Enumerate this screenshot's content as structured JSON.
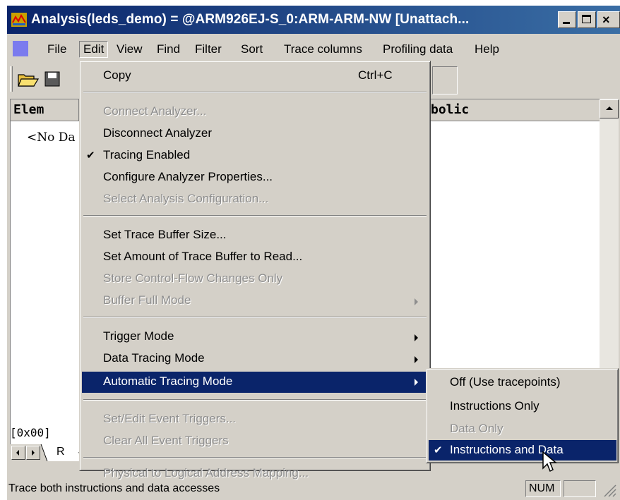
{
  "window": {
    "title": "Analysis(leds_demo) = @ARM926EJ-S_0:ARM-ARM-NW [Unattach...",
    "colors": {
      "titlebar_start": "#0a246a",
      "titlebar_end": "#3a6ea5",
      "highlight": "#0a246a",
      "face": "#d4d0c8"
    }
  },
  "menubar": {
    "items": [
      "File",
      "Edit",
      "View",
      "Find",
      "Filter",
      "Sort",
      "Trace columns",
      "Profiling data",
      "Help"
    ],
    "active": "Edit"
  },
  "toolbar": {
    "icons": [
      "open-folder-icon",
      "save-disk-icon"
    ]
  },
  "table": {
    "header_elem": "Elem",
    "header_symbolic": "bolic",
    "no_data": "<No Da",
    "address": "[0x00]",
    "tab_label": "R"
  },
  "edit_menu": {
    "copy": {
      "label": "Copy",
      "shortcut": "Ctrl+C"
    },
    "connect_analyzer": "Connect Analyzer...",
    "disconnect_analyzer": "Disconnect Analyzer",
    "tracing_enabled": "Tracing Enabled",
    "configure_properties": "Configure Analyzer Properties...",
    "select_config": "Select Analysis Configuration...",
    "set_buffer_size": "Set Trace Buffer Size...",
    "set_amount": "Set Amount of Trace Buffer to Read...",
    "store_control_flow": "Store Control-Flow Changes Only",
    "buffer_full_mode": "Buffer Full Mode",
    "trigger_mode": "Trigger Mode",
    "data_tracing_mode": "Data Tracing Mode",
    "automatic_tracing_mode": "Automatic Tracing Mode",
    "set_edit_triggers": "Set/Edit Event Triggers...",
    "clear_triggers": "Clear All Event Triggers",
    "physical_to_logical": "Physical to Logical Address Mapping..."
  },
  "submenu": {
    "off": "Off (Use tracepoints)",
    "instructions_only": "Instructions Only",
    "data_only": "Data Only",
    "instructions_and_data": "Instructions and Data"
  },
  "status": {
    "text": "Trace both instructions and data accesses",
    "num": "NUM"
  }
}
